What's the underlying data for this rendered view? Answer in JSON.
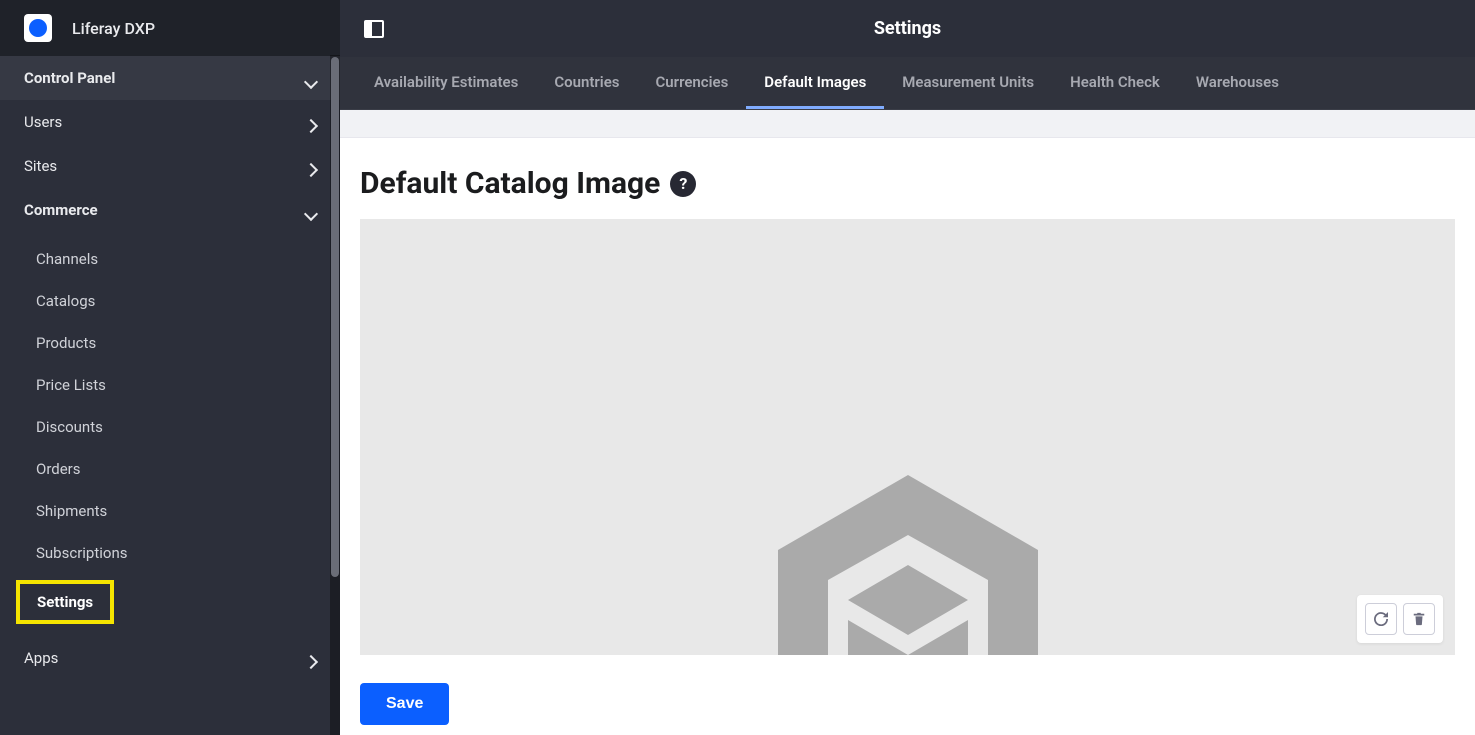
{
  "brand": {
    "name": "Liferay DXP"
  },
  "sidebar": {
    "control_panel": "Control Panel",
    "users": "Users",
    "sites": "Sites",
    "commerce": "Commerce",
    "commerce_items": [
      "Channels",
      "Catalogs",
      "Products",
      "Price Lists",
      "Discounts",
      "Orders",
      "Shipments",
      "Subscriptions",
      "Settings"
    ],
    "apps": "Apps"
  },
  "topbar": {
    "title": "Settings"
  },
  "tabs": [
    "Availability Estimates",
    "Countries",
    "Currencies",
    "Default Images",
    "Measurement Units",
    "Health Check",
    "Warehouses"
  ],
  "active_tab_index": 3,
  "page": {
    "heading": "Default Catalog Image",
    "help_glyph": "?",
    "save_label": "Save"
  }
}
